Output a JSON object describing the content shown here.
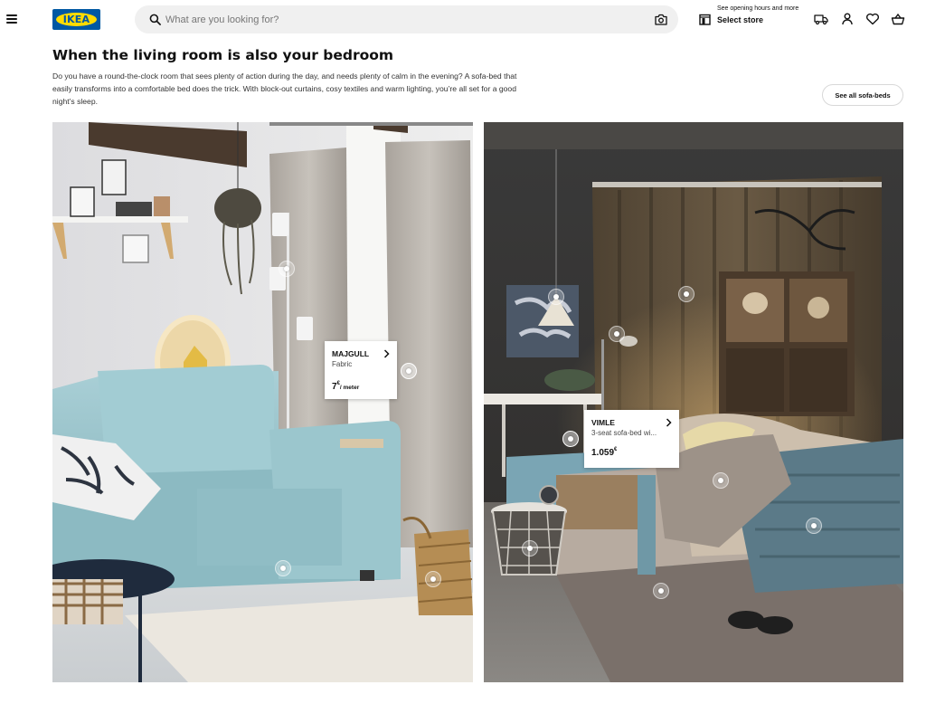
{
  "header": {
    "logo_text": "IKEA",
    "search_placeholder": "What are you looking for?",
    "store_small": "See opening hours and more",
    "store_label": "Select store"
  },
  "intro": {
    "title": "When the living room is also your bedroom",
    "description": "Do you have a round-the-clock room that sees plenty of action during the day, and needs plenty of calm in the evening? A sofa-bed that easily transforms into a comfortable bed does the trick. With block-out curtains, cosy textiles and warm lighting, you’re all set for a good night’s sleep.",
    "see_all_label": "See all sofa-beds"
  },
  "cards": {
    "majgull": {
      "name": "MAJGULL",
      "description": "Fabric",
      "price_int": "7",
      "price_sup": "€",
      "price_unit": "/ meter"
    },
    "vimle": {
      "name": "VIMLE",
      "description": "3-seat sofa-bed wi...",
      "price_int": "1.059",
      "price_sup": "€"
    }
  },
  "icons": {
    "menu": "hamburger-icon",
    "search": "search-icon",
    "camera": "camera-icon",
    "store": "store-icon",
    "delivery": "truck-icon",
    "account": "person-icon",
    "favourites": "heart-icon",
    "cart": "basket-icon"
  },
  "colors": {
    "ikea_blue": "#0058a3",
    "ikea_yellow": "#ffdb00",
    "search_bg": "#f0f0f0"
  }
}
